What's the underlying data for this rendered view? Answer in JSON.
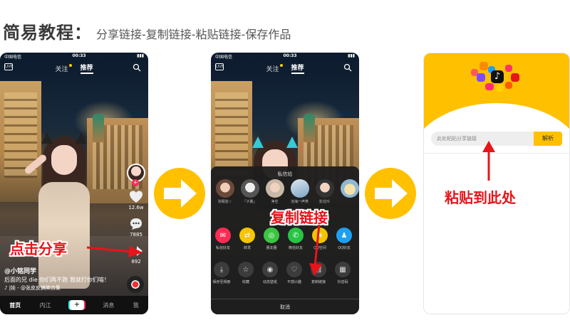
{
  "header": {
    "title": "简易教程：",
    "subtitle": "分享链接-复制链接-粘贴链接-保存作品"
  },
  "phone1": {
    "status": {
      "carrier": "中国电信",
      "time": "00:33"
    },
    "tabs": {
      "follow": "关注",
      "recommend": "推荐"
    },
    "actions": {
      "likes": "12.6w",
      "comments": "7885",
      "shares": "892"
    },
    "caption": {
      "user": "@小铭同学",
      "text": "后面的兄 die 你们再不跑 我就打你们喵！",
      "music": "♪ |娃 - @张皮皮搞笑合集"
    },
    "nav": [
      "首页",
      "内江",
      "+",
      "消息",
      "我"
    ],
    "overlay_label": "点击分享"
  },
  "phone2": {
    "status": {
      "carrier": "中国电信",
      "time": "00:33"
    },
    "tabs": {
      "follow": "关注",
      "recommend": "推荐"
    },
    "sheet_title": "私信给",
    "friends": [
      "张眠皆☆",
      "「子翼」",
      "净空",
      "池海一声笑",
      "彭任玲"
    ],
    "share_items": [
      "私信好友",
      "转发",
      "朋友圈",
      "微信好友",
      "QQ空间",
      "QQ好友"
    ],
    "tools": [
      "保存至相册",
      "收藏",
      "动态壁纸",
      "不感兴趣",
      "复制链接",
      "抖音码"
    ],
    "cancel": "取消",
    "overlay_label": "复制链接"
  },
  "phone3": {
    "input_placeholder": "此处粘贴分享链接",
    "parse_button": "解析",
    "overlay_label": "粘贴到此处"
  },
  "colors": {
    "accent_yellow": "#ffc000",
    "label_red": "#e8141a",
    "tiktok_red": "#fe2c55"
  }
}
